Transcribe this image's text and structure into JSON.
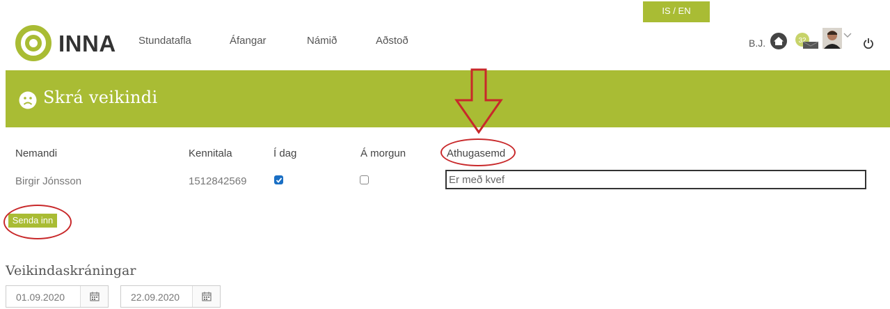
{
  "header": {
    "lang_toggle": "IS / EN",
    "logo_text": "INNA",
    "nav": [
      "Stundatafla",
      "Áfangar",
      "Námið",
      "Aðstoð"
    ],
    "user_initials": "B.J.",
    "message_count": "32"
  },
  "banner": {
    "title": "Skrá veikindi"
  },
  "table": {
    "headers": [
      "Nemandi",
      "Kennitala",
      "Í dag",
      "Á morgun",
      "Athugasemd"
    ],
    "row": {
      "name": "Birgir Jónsson",
      "id": "1512842569",
      "today_checked": true,
      "tomorrow_checked": false,
      "note": "Er með kvef"
    }
  },
  "actions": {
    "submit_label": "Senda inn"
  },
  "records": {
    "title": "Veikindaskráningar",
    "date_from": "01.09.2020",
    "date_to": "22.09.2020"
  },
  "colors": {
    "brand_green": "#a9bc34",
    "annotation_red": "#c8282a",
    "checkbox_blue": "#1a6fc4"
  }
}
